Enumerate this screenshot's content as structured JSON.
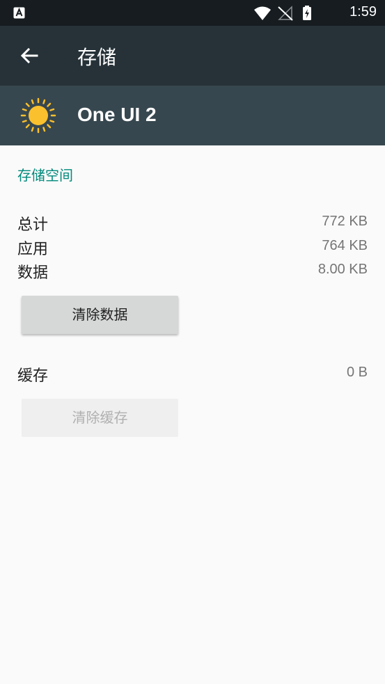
{
  "status_bar": {
    "time": "1:59",
    "icons": [
      "notification-a-icon",
      "wifi-icon",
      "no-signal-icon",
      "battery-charging-icon"
    ]
  },
  "toolbar": {
    "title": "存储",
    "back_icon": "arrow-back-icon"
  },
  "app_header": {
    "app_name": "One UI 2",
    "app_icon": "sun-icon",
    "icon_color": "#fbc02d"
  },
  "storage": {
    "section_title": "存储空间",
    "rows": [
      {
        "label": "总计",
        "value": "772 KB"
      },
      {
        "label": "应用",
        "value": "764 KB"
      },
      {
        "label": "数据",
        "value": "8.00 KB"
      }
    ],
    "clear_data_label": "清除数据"
  },
  "cache": {
    "label": "缓存",
    "value": "0 B",
    "clear_cache_label": "清除缓存"
  },
  "colors": {
    "toolbar": "#263238",
    "header": "#37474f",
    "accent": "#00897b",
    "status_bar": "#161c20"
  }
}
